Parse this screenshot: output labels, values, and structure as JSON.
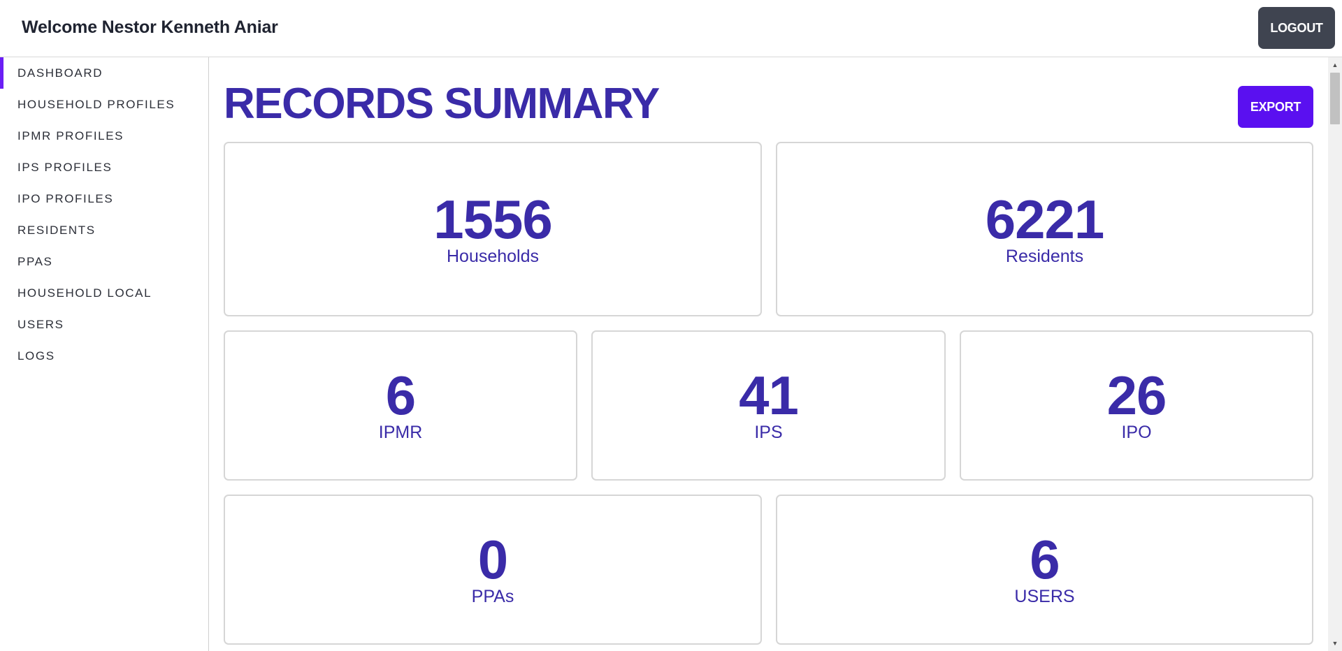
{
  "header": {
    "welcome_text": "Welcome Nestor Kenneth Aniar",
    "logout_label": "LOGOUT"
  },
  "sidebar": {
    "items": [
      {
        "label": "DASHBOARD",
        "active": true
      },
      {
        "label": "HOUSEHOLD PROFILES",
        "active": false
      },
      {
        "label": "IPMR PROFILES",
        "active": false
      },
      {
        "label": "IPS PROFILES",
        "active": false
      },
      {
        "label": "IPO PROFILES",
        "active": false
      },
      {
        "label": "RESIDENTS",
        "active": false
      },
      {
        "label": "PPAS",
        "active": false
      },
      {
        "label": "HOUSEHOLD LOCAL",
        "active": false
      },
      {
        "label": "USERS",
        "active": false
      },
      {
        "label": "LOGS",
        "active": false
      }
    ]
  },
  "main": {
    "title": "RECORDS SUMMARY",
    "export_label": "EXPORT",
    "cards": [
      {
        "value": "1556",
        "label": "Households"
      },
      {
        "value": "6221",
        "label": "Residents"
      },
      {
        "value": "6",
        "label": "IPMR"
      },
      {
        "value": "41",
        "label": "IPS"
      },
      {
        "value": "26",
        "label": "IPO"
      },
      {
        "value": "0",
        "label": "PPAs"
      },
      {
        "value": "6",
        "label": "USERS"
      }
    ]
  },
  "scrollbar": {
    "up_icon": "scroll-up-arrow-icon",
    "down_icon": "scroll-down-arrow-icon"
  },
  "colors": {
    "accent": "#3a2ba8",
    "export_button": "#5a10f0",
    "logout_button": "#3f4450",
    "active_indicator": "#6b1ff5"
  }
}
